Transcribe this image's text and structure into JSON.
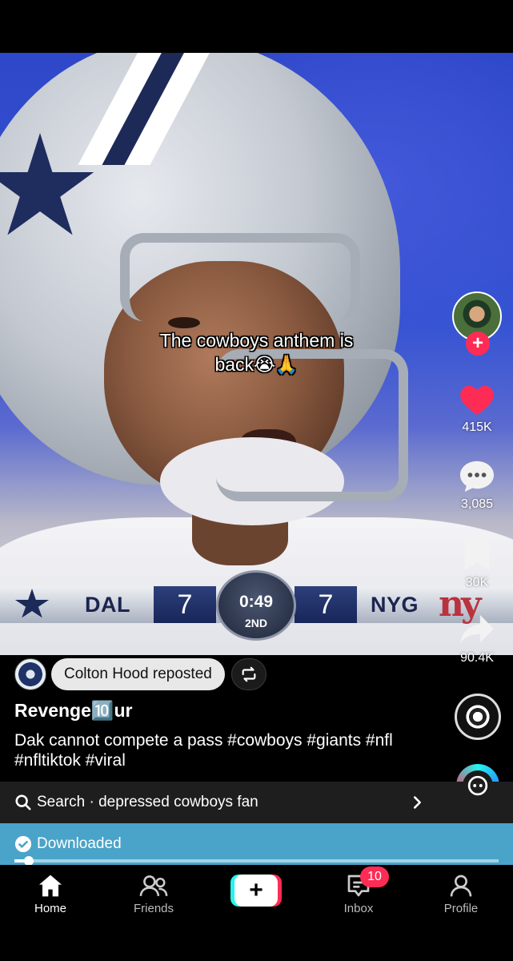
{
  "video": {
    "caption_line1": "The cowboys anthem is",
    "caption_line2": "back😭🙏",
    "scoreboard": {
      "home_team": "DAL",
      "home_score": "7",
      "clock": "0:49",
      "period": "2ND",
      "away_team": "NYG",
      "away_score": "7",
      "away_logo": "ny"
    }
  },
  "rail": {
    "likes": "415K",
    "comments": "3,085",
    "saves": "30K",
    "shares": "90.4K"
  },
  "post": {
    "reposted_by": "Colton Hood reposted",
    "username": "Revenge🔟ur",
    "description": "Dak cannot compete a pass #cowboys #giants #nfl #nfltiktok #viral"
  },
  "search": {
    "text": "Search · depressed cowboys fan"
  },
  "status": {
    "downloaded_label": "Downloaded",
    "progress": 0.02
  },
  "nav": {
    "home": "Home",
    "friends": "Friends",
    "inbox": "Inbox",
    "inbox_badge": "10",
    "profile": "Profile"
  },
  "colors": {
    "accent_red": "#fe2c55",
    "accent_cyan": "#25f4ee",
    "download_bar": "#4aa3c9"
  }
}
